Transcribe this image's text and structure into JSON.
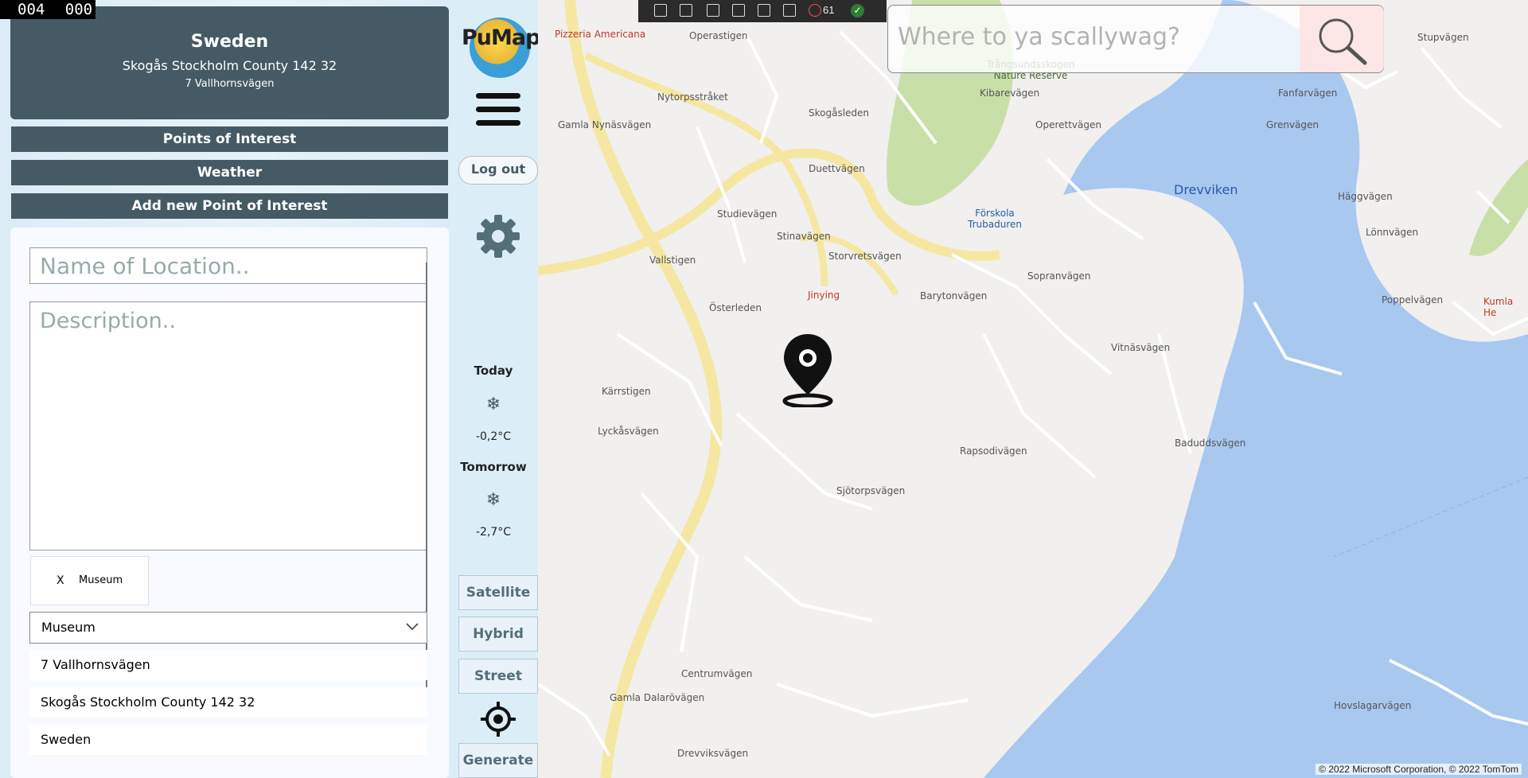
{
  "recorder": {
    "counter": "004 000"
  },
  "location": {
    "country": "Sweden",
    "region": "Skogås Stockholm County 142 32",
    "street": "7 Vallhornsvägen"
  },
  "menu": {
    "poi": "Points of Interest",
    "weather": "Weather",
    "add_poi": "Add new Point of Interest"
  },
  "form": {
    "name_placeholder": "Name of Location..",
    "desc_placeholder": "Description..",
    "tag_remove": "X",
    "tag_label": "Museum",
    "select_value": "Museum",
    "addresses": [
      "7 Vallhornsvägen",
      "Skogås Stockholm County 142 32",
      "Sweden"
    ]
  },
  "side": {
    "logo": "PuMap",
    "logout": "Log out",
    "today_label": "Today",
    "today_temp": "-0,2°C",
    "tomorrow_label": "Tomorrow",
    "tomorrow_temp": "-2,7°C",
    "weather_icon": "snowflake-icon",
    "modes": [
      "Satellite",
      "Hybrid",
      "Street"
    ],
    "generate": "Generate"
  },
  "toolbar": {
    "count": "61"
  },
  "search": {
    "placeholder": "Where to ya scallywag?"
  },
  "map": {
    "zoom_in": "+",
    "zoom_out": "−",
    "copyright": "© 2022 Microsoft Corporation, © 2022 TomTom",
    "places": {
      "pizzeria": "Pizzeria Americana",
      "jinying": "Jinying",
      "forskola": "Förskola Trubaduren",
      "nature_reserve": "Trångsundsskogen Nature Reserve",
      "drevviken": "Drevviken",
      "kumla": "Kumla He"
    },
    "streets": [
      "Operastigen",
      "Nytorpsstråket",
      "Skogåsleden",
      "Duettvägen",
      "Studievägen",
      "Stinavägen",
      "Storvretsvägen",
      "Vallstigen",
      "Österleden",
      "Kärrstigen",
      "Lyckåsvägen",
      "Sjötorpsvägen",
      "Rapsodivägen",
      "Barytonvägen",
      "Sopranvägen",
      "Vitnäsvägen",
      "Baduddsvägen",
      "Centrumvägen",
      "Gamla Dalarövägen",
      "Drevviksvägen",
      "Hovslagarvägen",
      "Gamla Nynäsvägen",
      "Kibarevägen",
      "Operettvägen",
      "Grenvägen",
      "Häggvägen",
      "Lönnvägen",
      "Poppelvägen",
      "Stupvägen",
      "Fanfarvägen"
    ]
  },
  "colors": {
    "panel": "#455a64",
    "water": "#a8c8f0",
    "road": "#f5e7a1",
    "park": "#c9dfa8"
  }
}
